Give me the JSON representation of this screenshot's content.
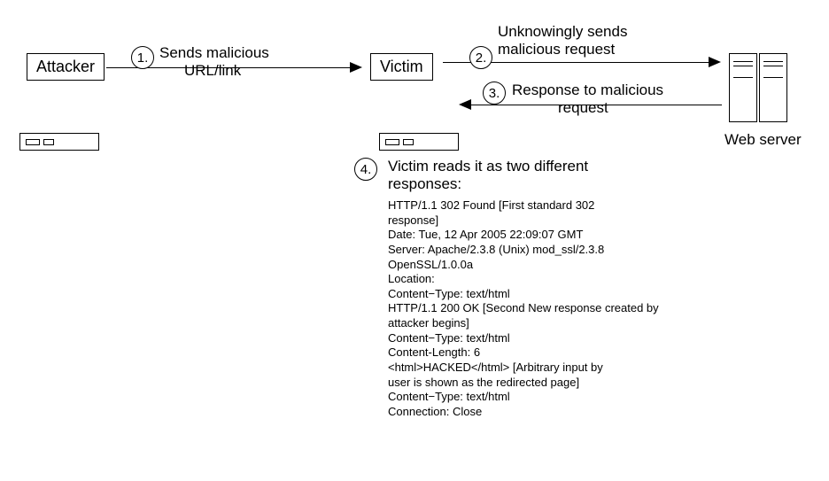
{
  "attacker": {
    "label": "Attacker"
  },
  "victim": {
    "label": "Victim"
  },
  "webserver": {
    "label": "Web server"
  },
  "steps": {
    "s1": {
      "num": "1.",
      "text1": "Sends malicious",
      "text2": "URL/link"
    },
    "s2": {
      "num": "2.",
      "text1": "Unknowingly sends",
      "text2": "malicious request"
    },
    "s3": {
      "num": "3.",
      "text1": "Response to malicious",
      "text2": "request"
    },
    "s4": {
      "num": "4."
    }
  },
  "response": {
    "heading1": "Victim reads it as two different",
    "heading2": "responses:",
    "lines": [
      "HTTP/1.1 302  Found [First standard 302",
      "response]",
      "Date: Tue, 12  Apr 2005  22:09:07  GMT",
      "Server: Apache/2.3.8 (Unix) mod_ssl/2.3.8",
      "OpenSSL/1.0.0a",
      "Location:",
      "Content−Type: text/html",
      "HTTP/1.1 200  OK [Second New response created by",
      "attacker begins]",
      "Content−Type: text/html",
      "Content-Length: 6",
      "<html>HACKED</html>  [Arbitrary input by",
      "user is shown as the redirected page]",
      "Content−Type: text/html",
      "Connection: Close"
    ]
  }
}
